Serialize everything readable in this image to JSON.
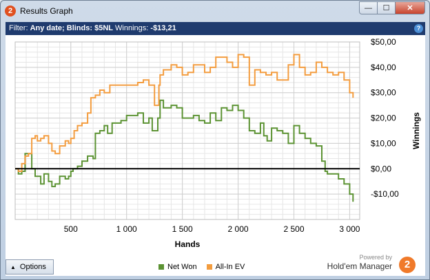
{
  "window": {
    "title": "Results Graph",
    "app_icon_glyph": "2",
    "minimize_glyph": "—",
    "maximize_glyph": "☐",
    "close_glyph": "✕"
  },
  "filter": {
    "prefix": "Filter:",
    "date": "Any date;",
    "blinds": "Blinds: $5NL",
    "winnings_label": "Winnings:",
    "winnings_value": "-$13,21",
    "help_glyph": "?"
  },
  "chart_data": {
    "type": "line",
    "xlabel": "Hands",
    "ylabel": "Winnings",
    "xlim": [
      1,
      3090
    ],
    "ylim": [
      -20,
      50
    ],
    "x_ticks": [
      500,
      1000,
      1500,
      2000,
      2500,
      3000
    ],
    "x_tick_labels": [
      "500",
      "1 000",
      "1 500",
      "2 000",
      "2 500",
      "3 000"
    ],
    "y_ticks": [
      50,
      40,
      30,
      20,
      10,
      0,
      -10
    ],
    "y_tick_labels": [
      "$50,00",
      "$40,00",
      "$30,00",
      "$20,00",
      "$10,00",
      "$0,00",
      "-$10,00"
    ],
    "grid": true,
    "zero_line": true,
    "series": [
      {
        "name": "Net Won",
        "color": "#5b9232",
        "x": [
          1,
          30,
          60,
          90,
          150,
          180,
          200,
          230,
          260,
          300,
          330,
          360,
          400,
          450,
          480,
          500,
          520,
          560,
          600,
          650,
          700,
          720,
          760,
          800,
          830,
          870,
          900,
          950,
          1000,
          1050,
          1100,
          1150,
          1200,
          1230,
          1280,
          1300,
          1330,
          1400,
          1450,
          1500,
          1550,
          1600,
          1650,
          1700,
          1750,
          1800,
          1850,
          1900,
          1950,
          2000,
          2050,
          2100,
          2150,
          2200,
          2230,
          2260,
          2300,
          2350,
          2400,
          2450,
          2500,
          2550,
          2600,
          2650,
          2700,
          2750,
          2780,
          2800,
          2850,
          2900,
          2950,
          3000,
          3030
        ],
        "y": [
          0,
          -2,
          -1,
          6,
          0,
          -3,
          -3,
          -6,
          -2,
          -5,
          -7,
          -6,
          -3,
          -4,
          -3,
          -1,
          0,
          1,
          3,
          5,
          4,
          14,
          15,
          17,
          14,
          18,
          18,
          19,
          21,
          21,
          22,
          18,
          20,
          15,
          20,
          27,
          24,
          25,
          24,
          20,
          20,
          21,
          19,
          18,
          22,
          19,
          24,
          23,
          25,
          23,
          20,
          15,
          14,
          18,
          13,
          11,
          16,
          15,
          14,
          10,
          17,
          14,
          12,
          10,
          9,
          3,
          -1,
          -2,
          -2,
          -4,
          -6,
          -10,
          -13
        ]
      },
      {
        "name": "All-In EV",
        "color": "#f39c3e",
        "x": [
          1,
          30,
          60,
          90,
          120,
          150,
          180,
          200,
          230,
          260,
          300,
          330,
          360,
          400,
          450,
          480,
          500,
          530,
          560,
          600,
          650,
          680,
          720,
          760,
          800,
          850,
          900,
          950,
          1000,
          1050,
          1100,
          1150,
          1200,
          1250,
          1290,
          1300,
          1330,
          1400,
          1450,
          1500,
          1550,
          1600,
          1650,
          1700,
          1750,
          1800,
          1850,
          1900,
          1950,
          2000,
          2050,
          2100,
          2150,
          2200,
          2250,
          2300,
          2350,
          2400,
          2450,
          2500,
          2550,
          2600,
          2650,
          2700,
          2750,
          2800,
          2850,
          2900,
          2950,
          3000,
          3030
        ],
        "y": [
          0,
          -1,
          2,
          5,
          6,
          12,
          13,
          11,
          12,
          13,
          10,
          7,
          6,
          9,
          11,
          10,
          12,
          15,
          17,
          18,
          22,
          28,
          29,
          31,
          30,
          33,
          33,
          33,
          33,
          33,
          34,
          35,
          33,
          25,
          33,
          37,
          39,
          41,
          40,
          37,
          38,
          41,
          41,
          38,
          40,
          44,
          44,
          42,
          40,
          45,
          44,
          33,
          39,
          38,
          37,
          38,
          35,
          35,
          41,
          45,
          40,
          37,
          38,
          42,
          40,
          38,
          37,
          38,
          35,
          30,
          28
        ]
      }
    ]
  },
  "bottom": {
    "options_label": "Options",
    "options_arrow": "▲",
    "legend": [
      {
        "label": "Net Won",
        "color": "#5b9232"
      },
      {
        "label": "All-In EV",
        "color": "#f39c3e"
      }
    ],
    "powered_by": "Powered by",
    "brand_name": "Hold'em Manager",
    "brand_logo_glyph": "2"
  }
}
